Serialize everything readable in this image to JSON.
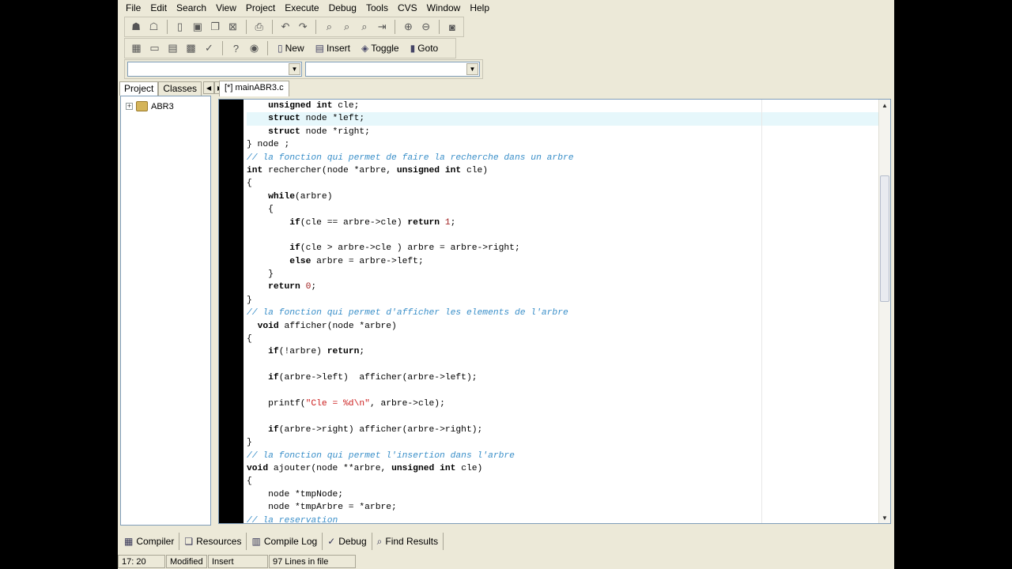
{
  "menu": [
    "File",
    "Edit",
    "Search",
    "View",
    "Project",
    "Execute",
    "Debug",
    "Tools",
    "CVS",
    "Window",
    "Help"
  ],
  "toolbar2": {
    "new_label": "New",
    "insert_label": "Insert",
    "toggle_label": "Toggle",
    "goto_label": "Goto"
  },
  "left_panel": {
    "tabs": [
      "Project",
      "Classes"
    ],
    "tree_item": "ABR3"
  },
  "editor": {
    "tab_label": "[*] mainABR3.c",
    "highlighted_line_index": 1,
    "lines": [
      "    unsigned int cle;",
      "    struct node *left;",
      "    struct node *right;",
      "} node ;",
      "// la fonction qui permet de faire la recherche dans un arbre",
      "int rechercher(node *arbre, unsigned int cle)",
      "{",
      "    while(arbre)",
      "    {",
      "        if(cle == arbre->cle) return 1;",
      "",
      "        if(cle > arbre->cle ) arbre = arbre->right;",
      "        else arbre = arbre->left;",
      "    }",
      "    return 0;",
      "}",
      "// la fonction qui permet d'afficher les elements de l'arbre",
      "  void afficher(node *arbre)",
      "{",
      "    if(!arbre) return;",
      "",
      "    if(arbre->left)  afficher(arbre->left);",
      "",
      "    printf(\"Cle = %d\\n\", arbre->cle);",
      "",
      "    if(arbre->right) afficher(arbre->right);",
      "}",
      "// la fonction qui permet l'insertion dans l'arbre",
      "void ajouter(node **arbre, unsigned int cle)",
      "{",
      "    node *tmpNode;",
      "    node *tmpArbre = *arbre;",
      "// la reservation"
    ]
  },
  "bottom_tabs": [
    "Compiler",
    "Resources",
    "Compile Log",
    "Debug",
    "Find Results"
  ],
  "status": {
    "position": "17: 20",
    "modified": "Modified",
    "mode": "Insert",
    "lines": "97 Lines in file"
  }
}
